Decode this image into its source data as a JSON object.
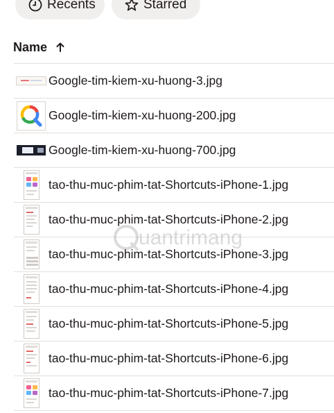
{
  "filters": {
    "recents_label": "Recents",
    "starred_label": "Starred"
  },
  "list_header": {
    "name_label": "Name",
    "sort": "ascending"
  },
  "files": [
    {
      "name": "Google-tim-kiem-xu-huong-3.jpg",
      "thumb": "wide"
    },
    {
      "name": "Google-tim-kiem-xu-huong-200.jpg",
      "thumb": "google-logo"
    },
    {
      "name": "Google-tim-kiem-xu-huong-700.jpg",
      "thumb": "dark"
    },
    {
      "name": "tao-thu-muc-phim-tat-Shortcuts-iPhone-1.jpg",
      "thumb": "phone-tiles"
    },
    {
      "name": "tao-thu-muc-phim-tat-Shortcuts-iPhone-2.jpg",
      "thumb": "phone-form"
    },
    {
      "name": "tao-thu-muc-phim-tat-Shortcuts-iPhone-3.jpg",
      "thumb": "phone-keyboard"
    },
    {
      "name": "tao-thu-muc-phim-tat-Shortcuts-iPhone-4.jpg",
      "thumb": "phone-list"
    },
    {
      "name": "tao-thu-muc-phim-tat-Shortcuts-iPhone-5.jpg",
      "thumb": "phone-list"
    },
    {
      "name": "tao-thu-muc-phim-tat-Shortcuts-iPhone-6.jpg",
      "thumb": "phone-form"
    },
    {
      "name": "tao-thu-muc-phim-tat-Shortcuts-iPhone-7.jpg",
      "thumb": "phone-tiles"
    }
  ],
  "watermark": {
    "text": "uantrimang"
  },
  "colors": {
    "chip_bg": "#f1efed",
    "divider": "#e3e0dd",
    "text": "#1e1919"
  }
}
